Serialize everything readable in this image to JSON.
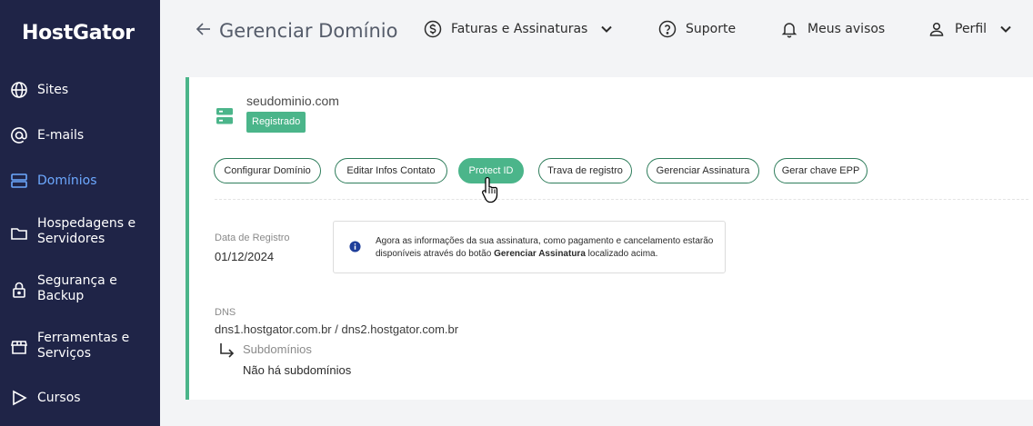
{
  "sidebar": {
    "logo": "HostGator",
    "items": [
      {
        "label": "Sites",
        "icon": "globe-icon"
      },
      {
        "label": "E-mails",
        "icon": "at-icon"
      },
      {
        "label": "Domínios",
        "icon": "server-icon",
        "active": true
      },
      {
        "label": "Hospedagens e Servidores",
        "icon": "folder-icon"
      },
      {
        "label": "Segurança e Backup",
        "icon": "lock-icon"
      },
      {
        "label": "Ferramentas e Serviços",
        "icon": "store-icon"
      },
      {
        "label": "Cursos",
        "icon": "play-icon"
      }
    ]
  },
  "header": {
    "title": "Gerenciar Domínio",
    "nav": {
      "billing": "Faturas e Assinaturas",
      "support": "Suporte",
      "notices": "Meus avisos",
      "profile": "Perfil"
    }
  },
  "domain": {
    "name": "seudominio.com",
    "status": "Registrado",
    "actions": [
      "Configurar Domínio",
      "Editar Infos Contato",
      "Protect ID",
      "Trava de registro",
      "Gerenciar Assinatura",
      "Gerar chave EPP"
    ],
    "registration_label": "Data de Registro",
    "registration_date": "01/12/2024",
    "info": {
      "text_before": "Agora as informações da sua assinatura, como pagamento e cancelamento estarão disponíveis através do botão ",
      "bold": "Gerenciar Assinatura",
      "text_after": " localizado acima."
    },
    "dns_label": "DNS",
    "dns_value": "dns1.hostgator.com.br / dns2.hostgator.com.br",
    "subdomains_label": "Subdomínios",
    "subdomains_value": "Não há subdomínios"
  },
  "colors": {
    "sidebar_bg": "#1f2447",
    "accent_green": "#4bb58a",
    "active_nav": "#6da9ff"
  }
}
